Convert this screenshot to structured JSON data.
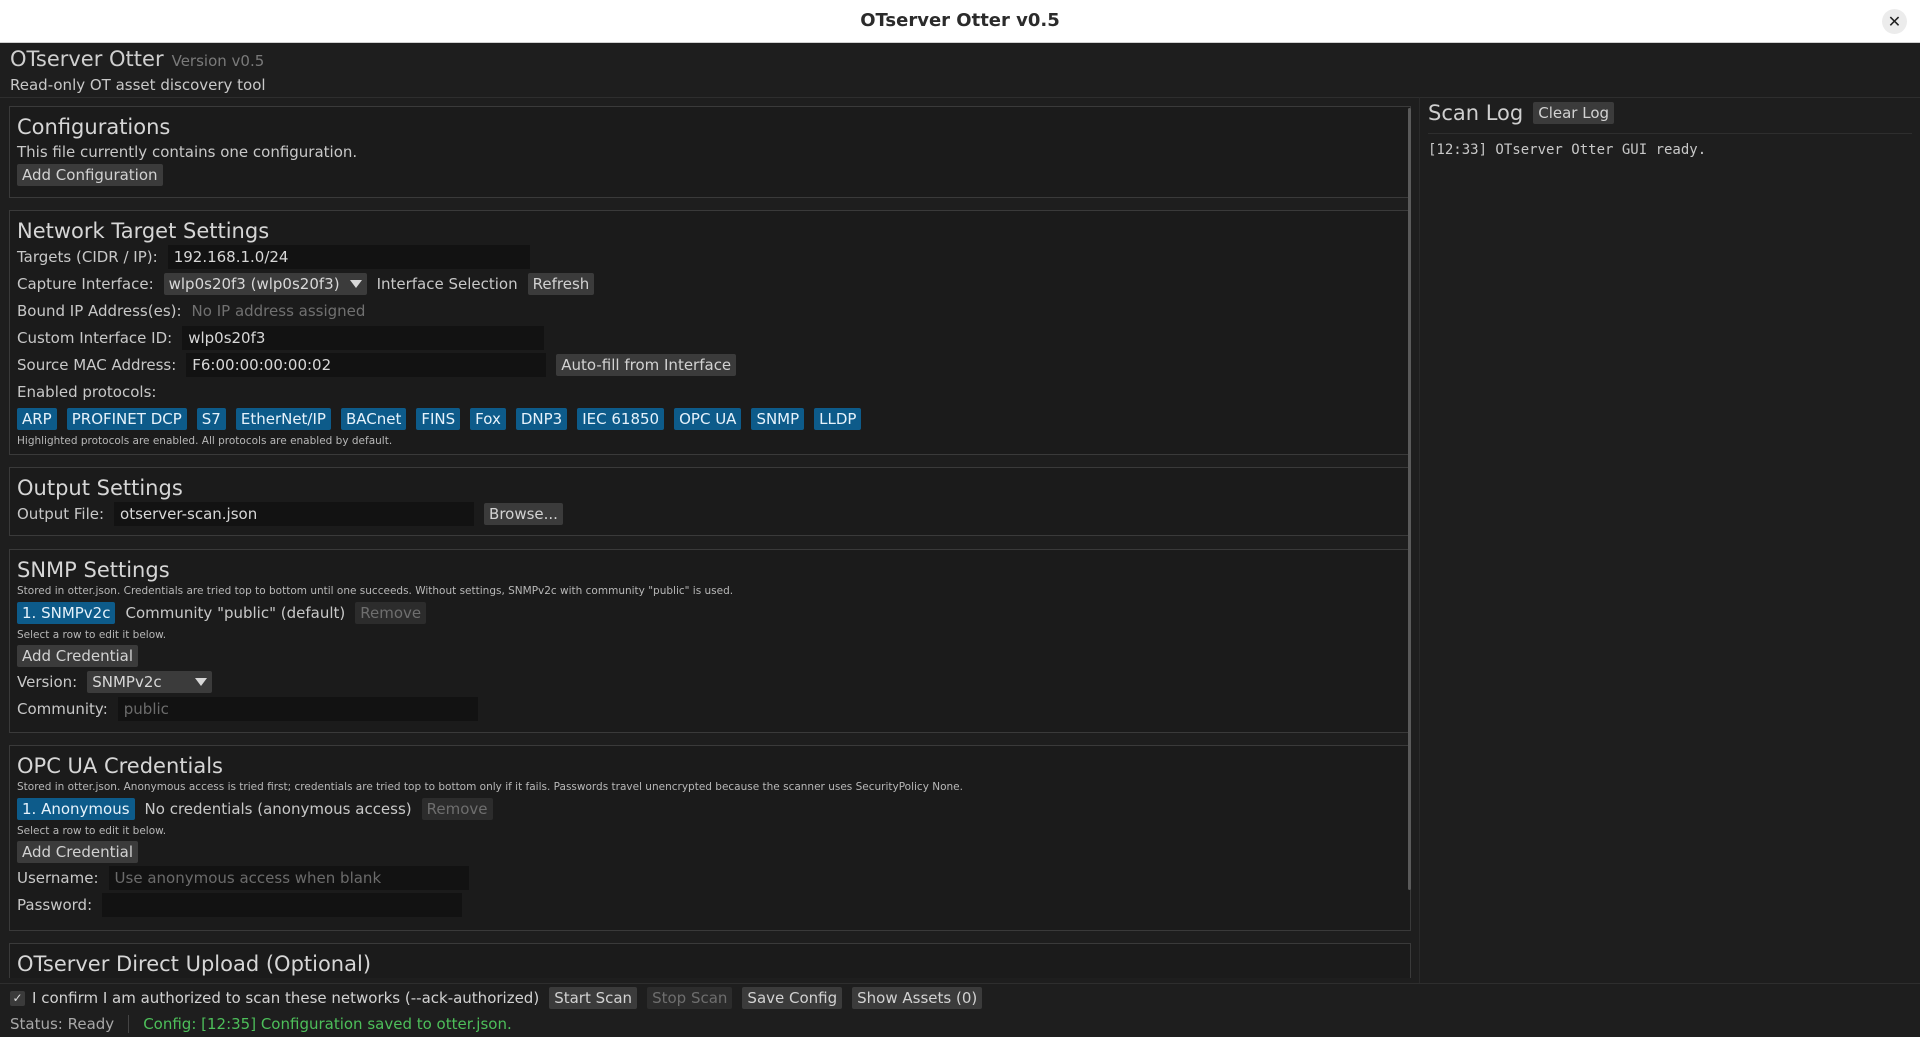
{
  "window": {
    "title": "OTserver Otter v0.5",
    "close_glyph": "✕"
  },
  "app": {
    "name": "OTserver Otter",
    "version": "Version v0.5",
    "tagline": "Read-only OT asset discovery tool"
  },
  "configurations": {
    "heading": "Configurations",
    "description": "This file currently contains one configuration.",
    "add_button": "Add Configuration"
  },
  "network": {
    "heading": "Network Target Settings",
    "targets_label": "Targets (CIDR / IP):",
    "targets_value": "192.168.1.0/24",
    "capture_label": "Capture Interface:",
    "capture_value": "wlp0s20f3 (wlp0s20f3)",
    "interface_selection_label": "Interface Selection",
    "refresh_button": "Refresh",
    "bound_ip_label": "Bound IP Address(es):",
    "bound_ip_value": "No IP address assigned",
    "custom_id_label": "Custom Interface ID:",
    "custom_id_value": "wlp0s20f3",
    "source_mac_label": "Source MAC Address:",
    "source_mac_value": "F6:00:00:00:00:02",
    "autofill_button": "Auto-fill from Interface",
    "protocols_label": "Enabled protocols:",
    "protocols": [
      "ARP",
      "PROFINET DCP",
      "S7",
      "EtherNet/IP",
      "BACnet",
      "FINS",
      "Fox",
      "DNP3",
      "IEC 61850",
      "OPC UA",
      "SNMP",
      "LLDP"
    ],
    "protocols_note": "Highlighted protocols are enabled. All protocols are enabled by default."
  },
  "output": {
    "heading": "Output Settings",
    "file_label": "Output File:",
    "file_value": "otserver-scan.json",
    "browse_button": "Browse..."
  },
  "snmp": {
    "heading": "SNMP Settings",
    "note": "Stored in otter.json. Credentials are tried top to bottom until one succeeds. Without settings, SNMPv2c with community \"public\" is used.",
    "entry_chip": "1. SNMPv2c",
    "entry_desc": "Community \"public\" (default)",
    "remove_button": "Remove",
    "select_hint": "Select a row to edit it below.",
    "add_button": "Add Credential",
    "version_label": "Version:",
    "version_value": "SNMPv2c",
    "community_label": "Community:",
    "community_placeholder": "public"
  },
  "opcua": {
    "heading": "OPC UA Credentials",
    "note": "Stored in otter.json. Anonymous access is tried first; credentials are tried top to bottom only if it fails. Passwords travel unencrypted because the scanner uses SecurityPolicy None.",
    "entry_chip": "1. Anonymous",
    "entry_desc": "No credentials (anonymous access)",
    "remove_button": "Remove",
    "select_hint": "Select a row to edit it below.",
    "add_button": "Add Credential",
    "username_label": "Username:",
    "username_placeholder": "Use anonymous access when blank",
    "password_label": "Password:",
    "password_value": ""
  },
  "upload": {
    "heading": "OTserver Direct Upload (Optional)"
  },
  "scan_log": {
    "title": "Scan Log",
    "clear_button": "Clear Log",
    "lines": [
      "[12:33] OTserver Otter GUI ready."
    ]
  },
  "actions": {
    "checkbox_mark": "✓",
    "confirm_label": "I confirm I am authorized to scan these networks (--ack-authorized)",
    "start_button": "Start Scan",
    "stop_button": "Stop Scan",
    "save_button": "Save Config",
    "assets_button": "Show Assets (0)"
  },
  "status": {
    "status_text": "Status: Ready",
    "config_text": "Config: [12:35] Configuration saved to otter.json."
  }
}
